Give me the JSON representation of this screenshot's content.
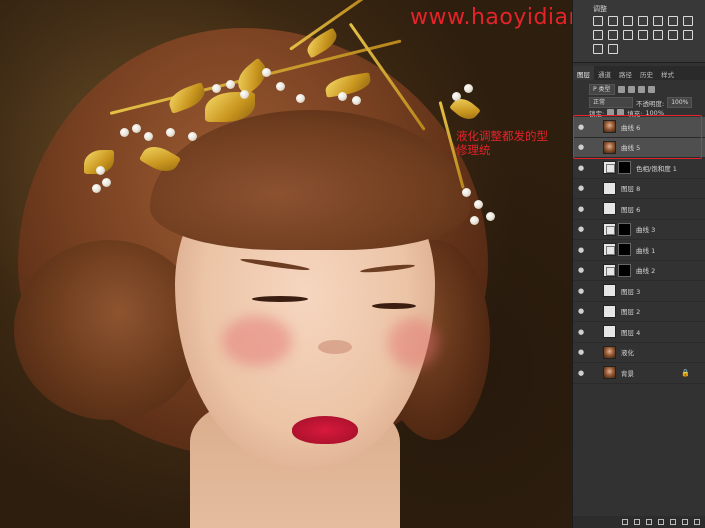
{
  "watermark": "www.haoyidian.cn",
  "annotation": "液化调整都发的型\n修理统",
  "adjustments_panel": {
    "title": "调整",
    "icon_count": 16
  },
  "layers_panel": {
    "tabs": [
      "图层",
      "通道",
      "路径",
      "历史",
      "样式"
    ],
    "kind_filter": "P 类型",
    "blend_mode": "正常",
    "opacity_label": "不透明度:",
    "opacity_value": "100%",
    "lock_label": "锁定:",
    "fill_label": "填充:",
    "fill_value": "100%"
  },
  "layers": [
    {
      "name": "曲线 6",
      "thumb": "photo",
      "mask": false,
      "selected": true
    },
    {
      "name": "曲线 5",
      "thumb": "photo",
      "mask": false,
      "selected": true
    },
    {
      "name": "色相/饱和度 1",
      "thumb": "adj",
      "mask": true,
      "selected": false
    },
    {
      "name": "图层 8",
      "thumb": "white",
      "mask": false,
      "selected": false
    },
    {
      "name": "图层 6",
      "thumb": "white",
      "mask": false,
      "selected": false
    },
    {
      "name": "曲线 3",
      "thumb": "adj",
      "mask": true,
      "selected": false
    },
    {
      "name": "曲线 1",
      "thumb": "adj",
      "mask": true,
      "selected": false
    },
    {
      "name": "曲线 2",
      "thumb": "adj",
      "mask": true,
      "selected": false
    },
    {
      "name": "图层 3",
      "thumb": "white",
      "mask": false,
      "selected": false
    },
    {
      "name": "图层 2",
      "thumb": "white",
      "mask": false,
      "selected": false
    },
    {
      "name": "图层 4",
      "thumb": "white",
      "mask": false,
      "selected": false
    },
    {
      "name": "液化",
      "thumb": "photo",
      "mask": false,
      "selected": false
    },
    {
      "name": "背景",
      "thumb": "photo",
      "mask": false,
      "selected": false,
      "locked": true
    }
  ],
  "icons": {
    "visibility": "eye-icon",
    "lock": "lock-icon"
  },
  "colors": {
    "annotation_red": "#e4232a",
    "panel_bg": "#323232",
    "selected_layer": "#4f4f4f"
  }
}
